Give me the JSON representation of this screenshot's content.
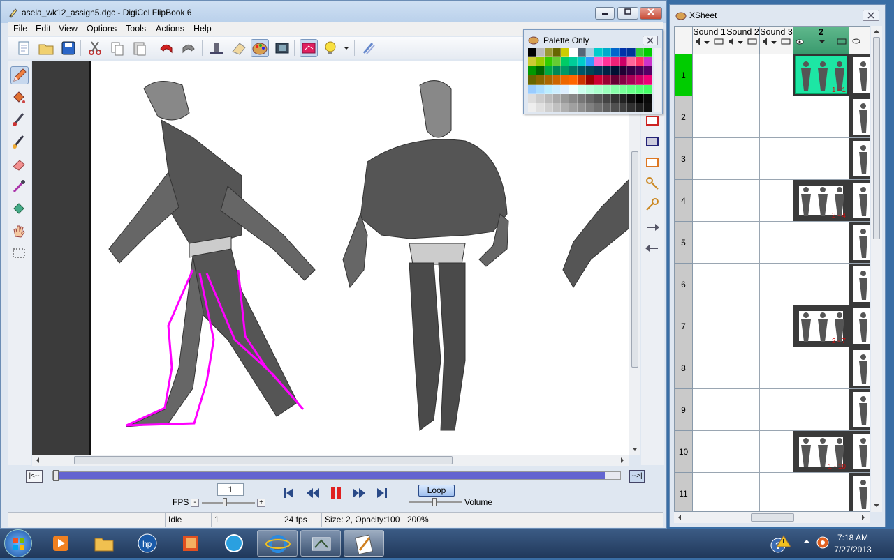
{
  "main_window": {
    "title": "asela_wk12_assign5.dgc - DigiCel FlipBook 6",
    "menu": [
      "File",
      "Edit",
      "View",
      "Options",
      "Tools",
      "Actions",
      "Help"
    ]
  },
  "timeline": {
    "start_button": "|<--",
    "end_button": "-->|",
    "position_fraction": 0.0
  },
  "playback": {
    "frame_value": "1",
    "fps_label": "FPS",
    "minus_label": "-",
    "plus_label": "+",
    "loop_label": "Loop",
    "volume_label": "Volume"
  },
  "status": {
    "state": "Idle",
    "frame": "1",
    "fps": "24 fps",
    "size": "Size:  2, Opacity:100",
    "zoom": "200%"
  },
  "palette": {
    "title": "Palette Only",
    "swatches": [
      "#000000",
      "#bbbbbb",
      "#999933",
      "#666600",
      "#cccc00",
      "#ffffff",
      "#556677",
      "#aaccdd",
      "#00cccc",
      "#00aacc",
      "#0066cc",
      "#0033aa",
      "#003399",
      "#33cc33",
      "#00cc00",
      "#cccc33",
      "#99cc00",
      "#33cc00",
      "#66cc33",
      "#00cc66",
      "#00cc99",
      "#00cccc",
      "#3399ff",
      "#ff66cc",
      "#ff3399",
      "#ee2277",
      "#cc0066",
      "#ff6699",
      "#ff3366",
      "#cc33cc",
      "#009900",
      "#006600",
      "#00aa44",
      "#008855",
      "#009966",
      "#007766",
      "#005566",
      "#004455",
      "#003355",
      "#002244",
      "#001133",
      "#220033",
      "#330044",
      "#440055",
      "#550066",
      "#666600",
      "#886600",
      "#aa6600",
      "#cc6600",
      "#ee6600",
      "#ff6600",
      "#cc3300",
      "#990000",
      "#cc0033",
      "#990033",
      "#660033",
      "#880044",
      "#aa0055",
      "#cc0066",
      "#ee0077",
      "#99ccff",
      "#aaddff",
      "#bbeeff",
      "#cceeff",
      "#ddeeff",
      "#eeffff",
      "#ccffee",
      "#bbffdd",
      "#aaffcc",
      "#99ffbb",
      "#88ffaa",
      "#77ff99",
      "#66ff88",
      "#55ff77",
      "#44ff66",
      "#dddddd",
      "#cccccc",
      "#bbbbbb",
      "#aaaaaa",
      "#999999",
      "#888888",
      "#777777",
      "#666666",
      "#555555",
      "#444444",
      "#333333",
      "#222222",
      "#111111",
      "#000000",
      "#0a0a0a",
      "#eeeeee",
      "#e0e0e0",
      "#d0d0d0",
      "#c0c0c0",
      "#b0b0b0",
      "#a0a0a0",
      "#909090",
      "#808080",
      "#707070",
      "#606060",
      "#505050",
      "#404040",
      "#303030",
      "#202020",
      "#101010"
    ]
  },
  "xsheet": {
    "title": "XSheet",
    "columns": [
      "Sound 1",
      "Sound 2",
      "Sound 3",
      "2"
    ],
    "rows": [
      {
        "num": "1",
        "label": "1 - 1"
      },
      {
        "num": "2",
        "label": ""
      },
      {
        "num": "3",
        "label": ""
      },
      {
        "num": "4",
        "label": "2 - 4"
      },
      {
        "num": "5",
        "label": ""
      },
      {
        "num": "6",
        "label": ""
      },
      {
        "num": "7",
        "label": "2 - 7"
      },
      {
        "num": "8",
        "label": ""
      },
      {
        "num": "9",
        "label": ""
      },
      {
        "num": "10",
        "label": "1 - 10"
      },
      {
        "num": "11",
        "label": ""
      }
    ]
  },
  "taskbar": {
    "time": "7:18 AM",
    "date": "7/27/2013"
  },
  "colors": {
    "accent": "#00cc00",
    "selected_cell": "#1de6a4",
    "timeline_fill": "#6464d0",
    "stroke_magenta": "#ff00ff"
  }
}
